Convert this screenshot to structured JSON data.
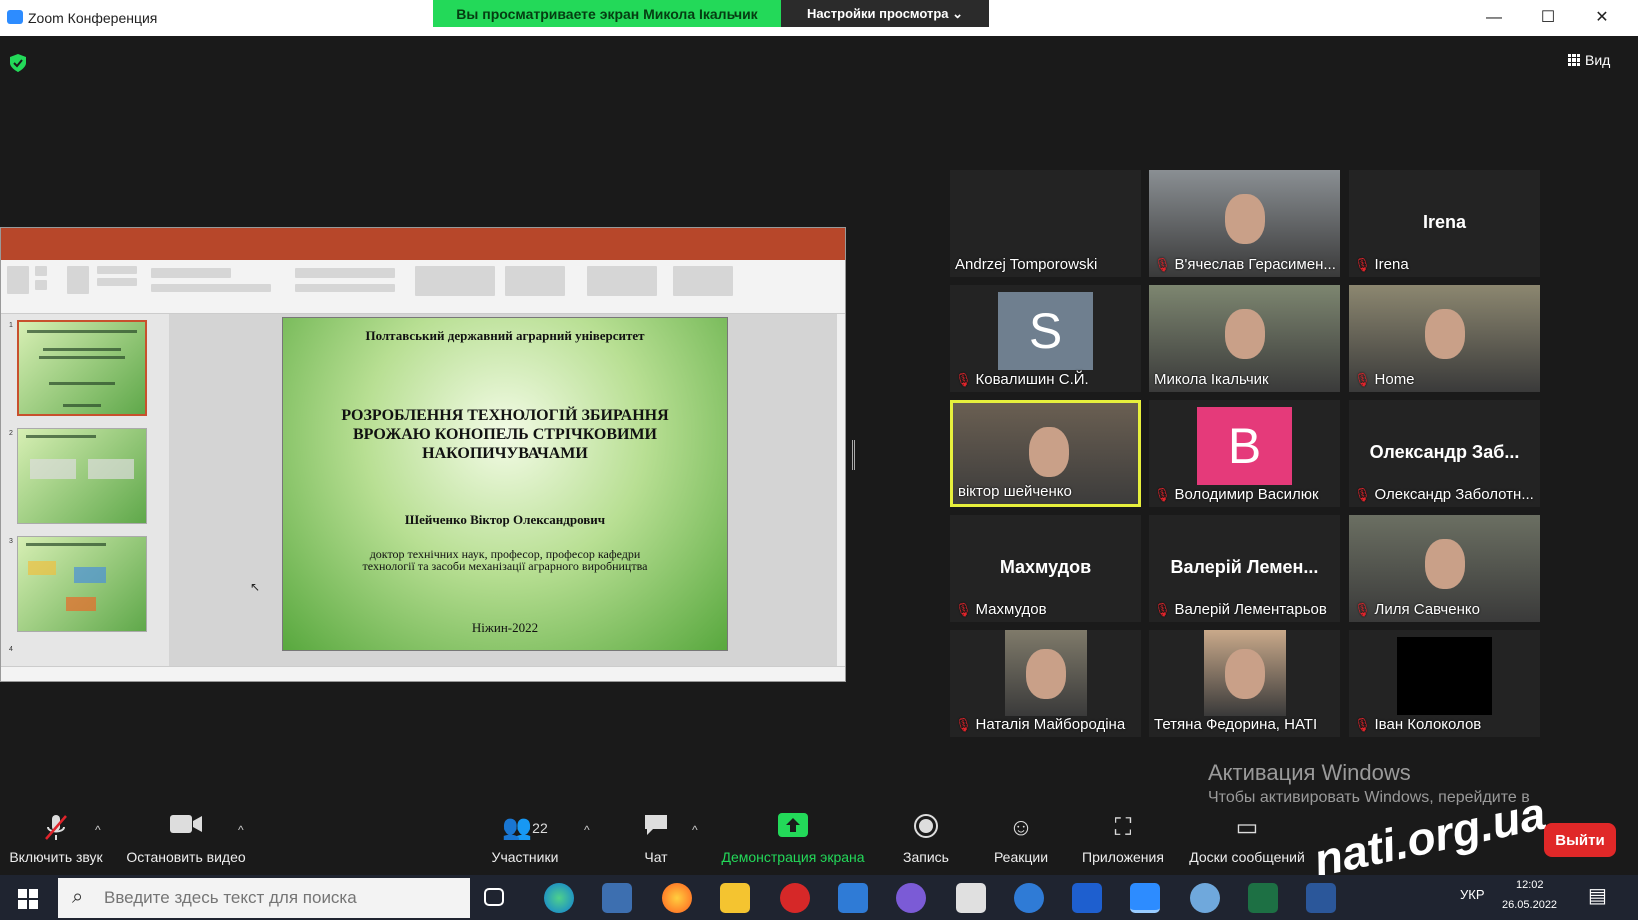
{
  "window": {
    "title": "Zoom Конференция",
    "share_banner": "Вы просматриваете экран Микола Ікальчик",
    "view_options": "Настройки просмотра",
    "view_button": "Вид"
  },
  "slide": {
    "university": "Полтавський державний аграрний університет",
    "title": "РОЗРОБЛЕННЯ ТЕХНОЛОГІЙ ЗБИРАННЯ ВРОЖАЮ КОНОПЕЛЬ СТРІЧКОВИМИ НАКОПИЧУВАЧАМИ",
    "author": "Шейченко Віктор Олександрович",
    "degree": "доктор технічних наук, професор, професор кафедри технології та засоби механізації аграрного виробництва",
    "city_year": "Ніжин-2022"
  },
  "participants": [
    {
      "name": "Andrzej Tomporowski",
      "muted": false,
      "type": "blank"
    },
    {
      "name": "В'ячеслав Герасимен...",
      "muted": true,
      "type": "video",
      "bg": "#8a8f93"
    },
    {
      "name": "Irena",
      "big": "Irena",
      "muted": true,
      "type": "text"
    },
    {
      "name": "Ковалишин С.Й.",
      "muted": true,
      "type": "avatar",
      "letter": "S",
      "color": "#6f7f8f"
    },
    {
      "name": "Микола Ікальчик",
      "muted": false,
      "type": "video",
      "bg": "#7d8670"
    },
    {
      "name": "Home",
      "muted": true,
      "type": "video",
      "bg": "#8c8770"
    },
    {
      "name": "віктор шейченко",
      "muted": false,
      "type": "video",
      "bg": "#6a5f52",
      "speaker": true
    },
    {
      "name": "Володимир Василюк",
      "muted": true,
      "type": "avatar",
      "letter": "B",
      "color": "#e53a7a"
    },
    {
      "name": "Олександр Заболотн...",
      "big": "Олександр Заб...",
      "muted": true,
      "type": "text"
    },
    {
      "name": "Махмудов",
      "big": "Махмудов",
      "muted": true,
      "type": "text"
    },
    {
      "name": "Валерій Лементарьов",
      "big": "Валерій Лемен...",
      "muted": true,
      "type": "text"
    },
    {
      "name": "Лиля Савченко",
      "muted": true,
      "type": "video",
      "bg": "#6b6f62"
    },
    {
      "name": "Наталія Майбородіна",
      "muted": true,
      "type": "video",
      "bg": "#7f7a6a"
    },
    {
      "name": "Тетяна Федорина, НАТІ",
      "muted": false,
      "type": "video",
      "bg": "#c9a98a"
    },
    {
      "name": "Іван Колоколов",
      "muted": true,
      "type": "black"
    }
  ],
  "watermark": {
    "heading": "Активация Windows",
    "text": "Чтобы активировать Windows, перейдите в раздел \"Параметры\"."
  },
  "toolbar": {
    "unmute": "Включить звук",
    "stop_video": "Остановить видео",
    "participants": "Участники",
    "participants_count": "22",
    "chat": "Чат",
    "share": "Демонстрация экрана",
    "record": "Запись",
    "reactions": "Реакции",
    "apps": "Приложения",
    "whiteboards": "Доски сообщений",
    "leave": "Выйти"
  },
  "overlay_logo": "nati.org.ua",
  "taskbar": {
    "search_placeholder": "Введите здесь текст для поиска",
    "lang": "УКР",
    "time": "12:02",
    "date": "26.05.2022"
  },
  "colors": {
    "green": "#23d959",
    "ppt_red": "#b7472a",
    "leave_red": "#e02828",
    "speaker_border": "#e7f03c"
  }
}
